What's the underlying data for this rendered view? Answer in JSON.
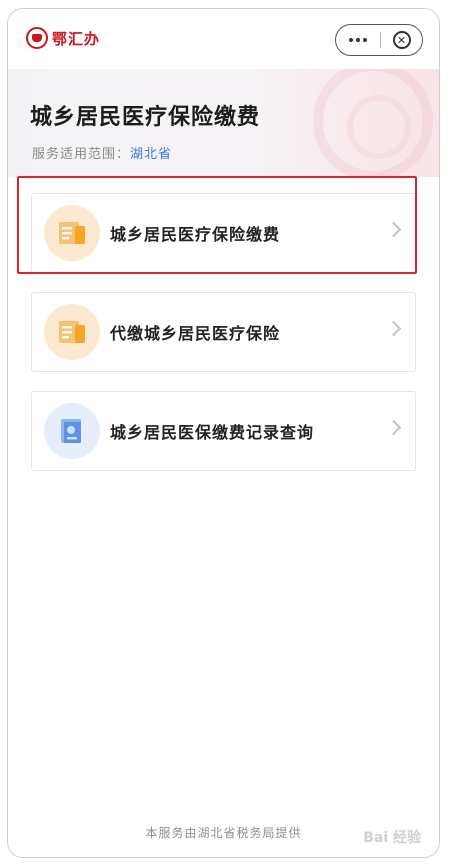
{
  "app": {
    "logo_text": "鄂汇办"
  },
  "banner": {
    "title": "城乡居民医疗保险缴费",
    "scope_label": "服务适用范围：",
    "scope_value": "湖北省"
  },
  "items": [
    {
      "label": "城乡居民医疗保险缴费",
      "icon": "document-icon",
      "color": "#f5a623"
    },
    {
      "label": "代缴城乡居民医疗保险",
      "icon": "document-icon",
      "color": "#f5a623"
    },
    {
      "label": "城乡居民医保缴费记录查询",
      "icon": "record-icon",
      "color": "#4a86e8"
    }
  ],
  "footer": {
    "text": "本服务由湖北省税务局提供"
  },
  "watermark": {
    "text": "Bai 经验"
  },
  "colors": {
    "brand": "#c8161d",
    "highlight": "#d9262c",
    "link": "#3a7bd5"
  }
}
